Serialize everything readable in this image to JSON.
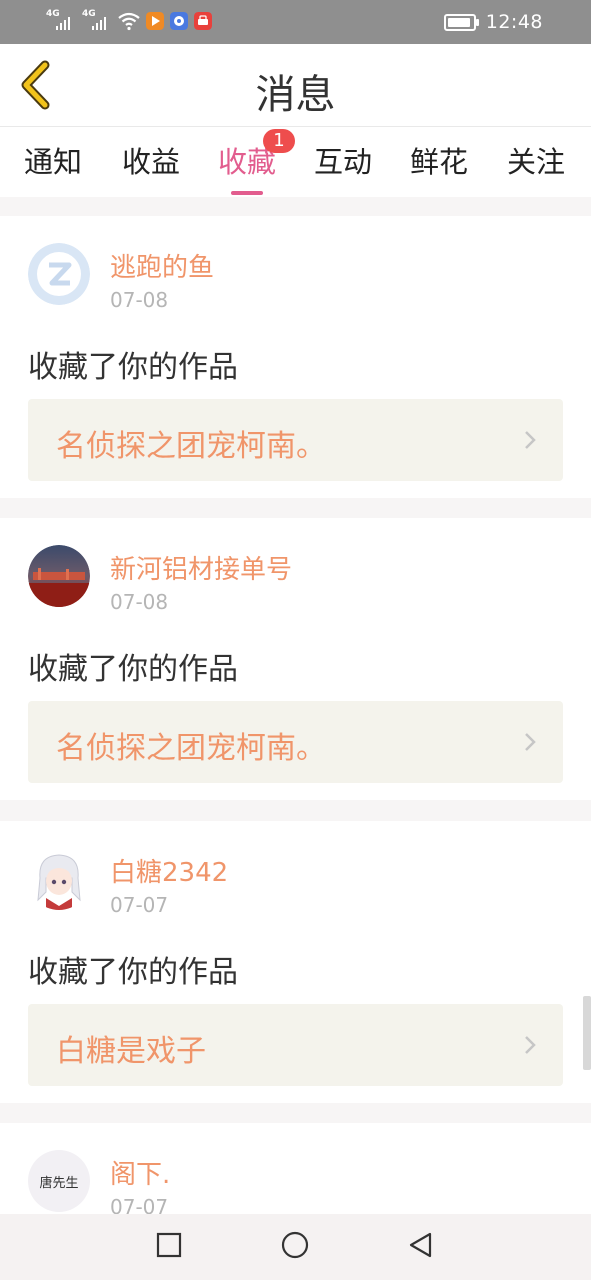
{
  "status_bar": {
    "net1": "4G",
    "net2": "4G",
    "time": "12:48",
    "icons": [
      "signal-icon",
      "signal-icon",
      "wifi-icon",
      "video-app-icon",
      "music-app-icon",
      "shop-app-icon",
      "battery-icon"
    ]
  },
  "header": {
    "title": "消息",
    "back_icon": "back-chevron-icon"
  },
  "tabs": [
    {
      "label": "通知"
    },
    {
      "label": "收益"
    },
    {
      "label": "收藏",
      "active": true,
      "badge": "1"
    },
    {
      "label": "互动"
    },
    {
      "label": "鲜花"
    },
    {
      "label": "关注"
    }
  ],
  "messages": [
    {
      "user": "逃跑的鱼",
      "date": "07-08",
      "action": "收藏了你的作品",
      "work": "名侦探之团宠柯南。",
      "avatar": "default-avatar-icon"
    },
    {
      "user": "新河铝材接单号",
      "date": "07-08",
      "action": "收藏了你的作品",
      "work": "名侦探之团宠柯南。",
      "avatar": "photo-avatar"
    },
    {
      "user": "白糖2342",
      "date": "07-07",
      "action": "收藏了你的作品",
      "work": "白糖是戏子",
      "avatar": "anime-avatar"
    },
    {
      "user": "阁下.",
      "date": "07-07",
      "avatar_text": "唐先生",
      "avatar": "text-avatar"
    }
  ],
  "nav_bar": {
    "icons": [
      "recent-apps-icon",
      "home-icon",
      "back-icon"
    ]
  },
  "colors": {
    "accent": "#e25d8e",
    "name_orange": "#f0956a",
    "badge": "#ee4d4d",
    "work_bg": "#f4f3ec",
    "back_yellow": "#f2c31b"
  }
}
